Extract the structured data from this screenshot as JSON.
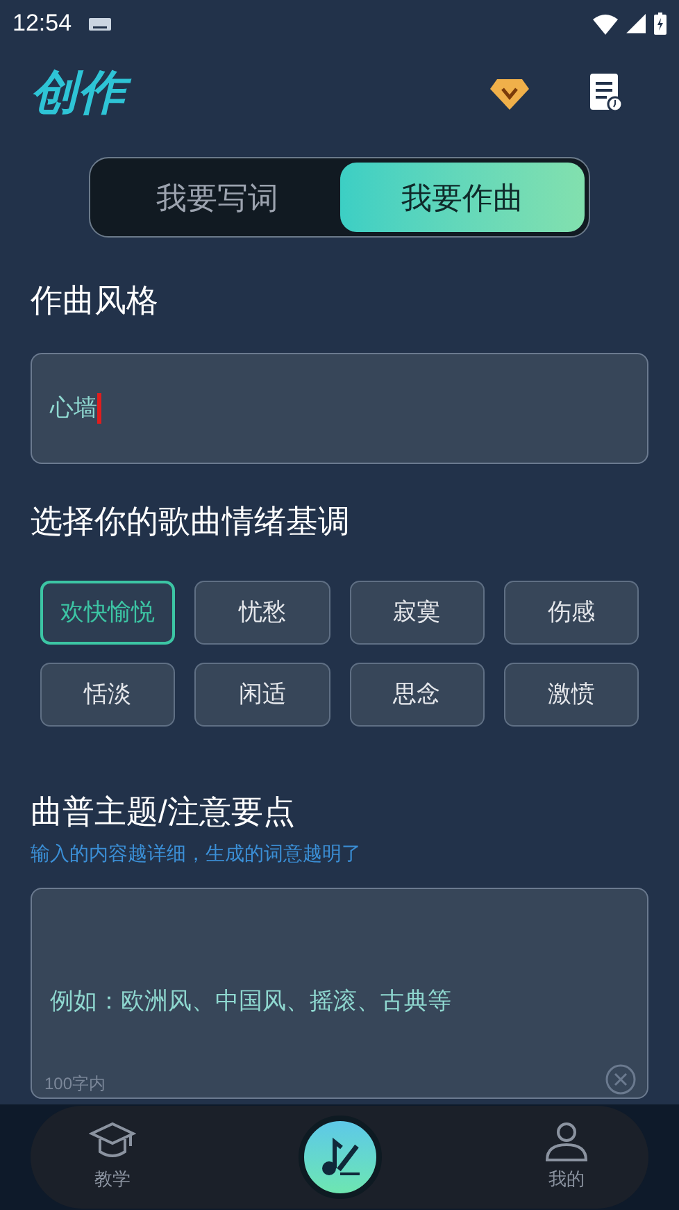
{
  "status_bar": {
    "time": "12:54"
  },
  "header": {
    "title": "创作"
  },
  "tabs": [
    {
      "label": "我要写词",
      "selected": false
    },
    {
      "label": "我要作曲",
      "selected": true
    }
  ],
  "style_section": {
    "title": "作曲风格",
    "value": "心墙"
  },
  "mood_section": {
    "title": "选择你的歌曲情绪基调",
    "moods": [
      {
        "label": "欢快愉悦",
        "selected": true
      },
      {
        "label": "忧愁",
        "selected": false
      },
      {
        "label": "寂寞",
        "selected": false
      },
      {
        "label": "伤感",
        "selected": false
      },
      {
        "label": "恬淡",
        "selected": false
      },
      {
        "label": "闲适",
        "selected": false
      },
      {
        "label": "思念",
        "selected": false
      },
      {
        "label": "激愤",
        "selected": false
      }
    ]
  },
  "theme_section": {
    "title": "曲普主题/注意要点",
    "hint": "输入的内容越详细，生成的词意越明了",
    "placeholder": "例如：欧洲风、中国风、摇滚、古典等",
    "counter": "100字内"
  },
  "bottom_nav": {
    "items": [
      {
        "label": "教学"
      },
      {
        "label": "我的"
      }
    ]
  }
}
